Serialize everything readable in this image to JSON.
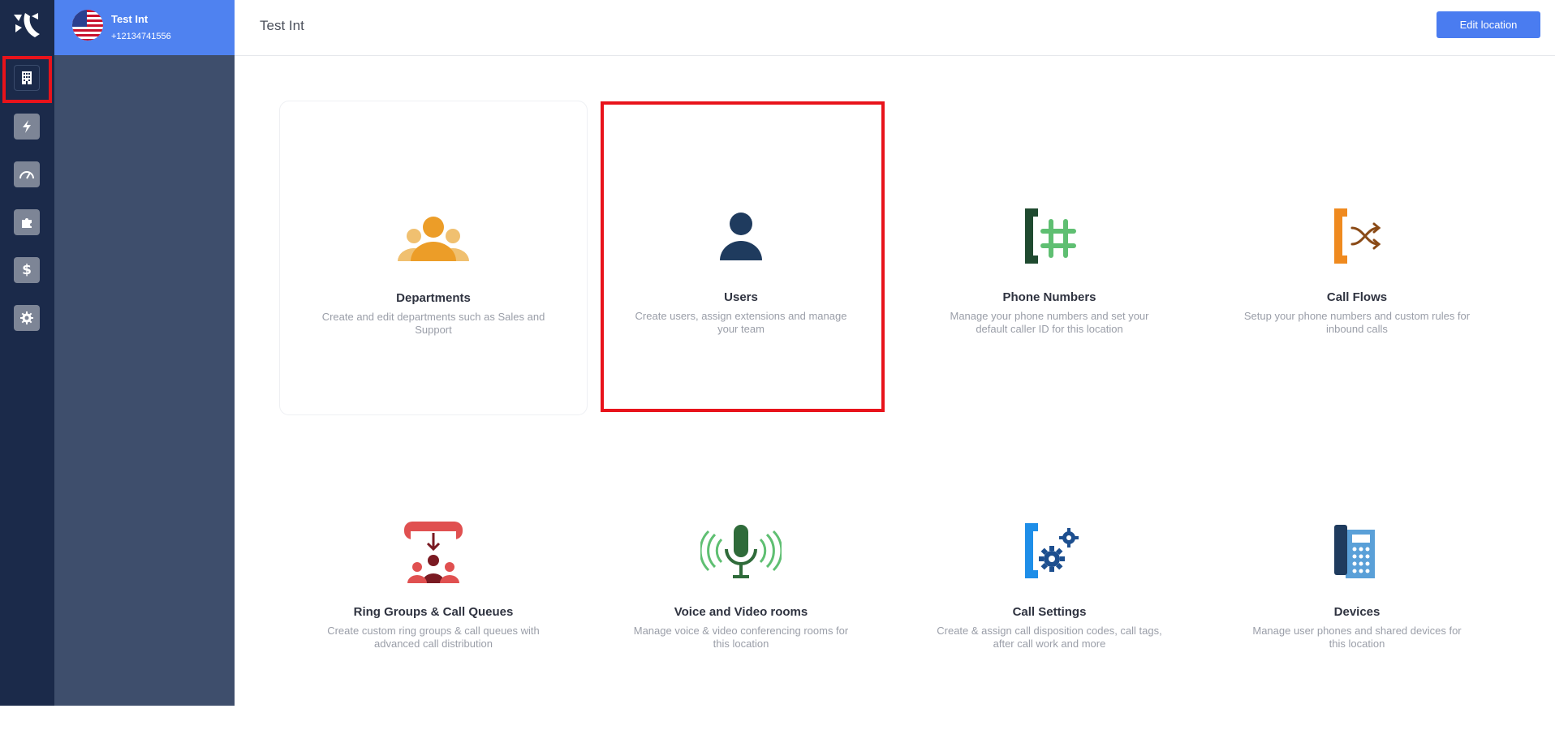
{
  "account": {
    "name": "Test Int",
    "phone": "+12134741556"
  },
  "header": {
    "title": "Test Int",
    "edit_label": "Edit location"
  },
  "cards": [
    {
      "title": "Departments",
      "desc": "Create and edit departments such as Sales and Support",
      "icon": "departments-icon"
    },
    {
      "title": "Users",
      "desc": "Create users, assign extensions and manage your team",
      "icon": "user-icon"
    },
    {
      "title": "Phone Numbers",
      "desc": "Manage your phone numbers and set your default caller ID for this location",
      "icon": "phone-hash-icon"
    },
    {
      "title": "Call Flows",
      "desc": "Setup your phone numbers and custom rules for inbound calls",
      "icon": "call-flow-icon"
    },
    {
      "title": "Ring Groups & Call Queues",
      "desc": "Create custom ring groups & call queues with advanced call distribution",
      "icon": "ring-groups-icon"
    },
    {
      "title": "Voice and Video rooms",
      "desc": "Manage voice & video conferencing rooms for this location",
      "icon": "microphone-icon"
    },
    {
      "title": "Call Settings",
      "desc": "Create & assign call disposition codes, call tags, after call work and more",
      "icon": "call-settings-icon"
    },
    {
      "title": "Devices",
      "desc": "Manage user phones and shared devices for this location",
      "icon": "desk-phone-icon"
    }
  ],
  "colors": {
    "rail": "#1b2a4a",
    "panel": "#3e4e6c",
    "accent": "#4a7cf0",
    "highlight": "#e8131b"
  }
}
